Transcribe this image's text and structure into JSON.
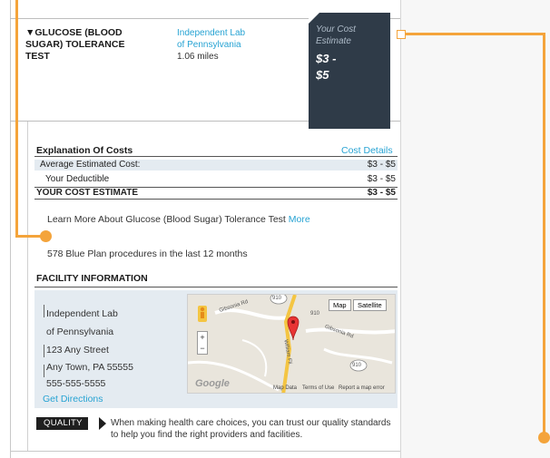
{
  "test": {
    "name_lines": [
      "▼GLUCOSE (BLOOD",
      "SUGAR) TOLERANCE",
      "TEST"
    ],
    "provider_lines": [
      "Independent Lab",
      "of Pennsylvania"
    ],
    "distance": "1.06 miles"
  },
  "cost_box": {
    "label_lines": [
      "Your Cost",
      "Estimate"
    ],
    "range_lines": [
      "$3 -",
      "$5"
    ]
  },
  "explanation": {
    "title": "Explanation Of Costs",
    "details_link": "Cost Details",
    "rows": [
      {
        "label": "Average Estimated Cost:",
        "value": "$3 - $5"
      },
      {
        "label": "Your Deductible",
        "value": "$3 - $5"
      }
    ],
    "total": {
      "label": "YOUR COST ESTIMATE",
      "value": "$3 - $5"
    }
  },
  "learn_more": {
    "text": "Learn More About Glucose (Blood Sugar) Tolerance Test",
    "link": "More"
  },
  "procedures_text": "578 Blue Plan procedures in the last 12 months",
  "facility": {
    "title": "FACILITY INFORMATION",
    "address_lines": [
      "Independent Lab",
      "of Pennsylvania",
      "123 Any Street",
      "Any Town, PA 55555",
      "555-555-5555"
    ],
    "directions_link": "Get Directions",
    "map": {
      "map_button": "Map",
      "satellite_button": "Satellite",
      "zoom_in": "+",
      "zoom_out": "−",
      "logo": "Google",
      "footer_links": [
        "Map Data",
        "Terms of Use",
        "Report a map error"
      ],
      "road_labels": [
        "Gibsonia Rd",
        "Gibsonia Rd",
        "William Fli",
        "910",
        "910",
        "910"
      ]
    }
  },
  "quality": {
    "badge": "QUALITY",
    "text": "When making health care choices, you can trust our quality standards to help you find the right providers and facilities."
  },
  "colors": {
    "accent_orange": "#f4a43b",
    "link_blue": "#27a3d3",
    "cost_box_bg": "#2f3b48",
    "row_shade": "#e4ebf1"
  }
}
